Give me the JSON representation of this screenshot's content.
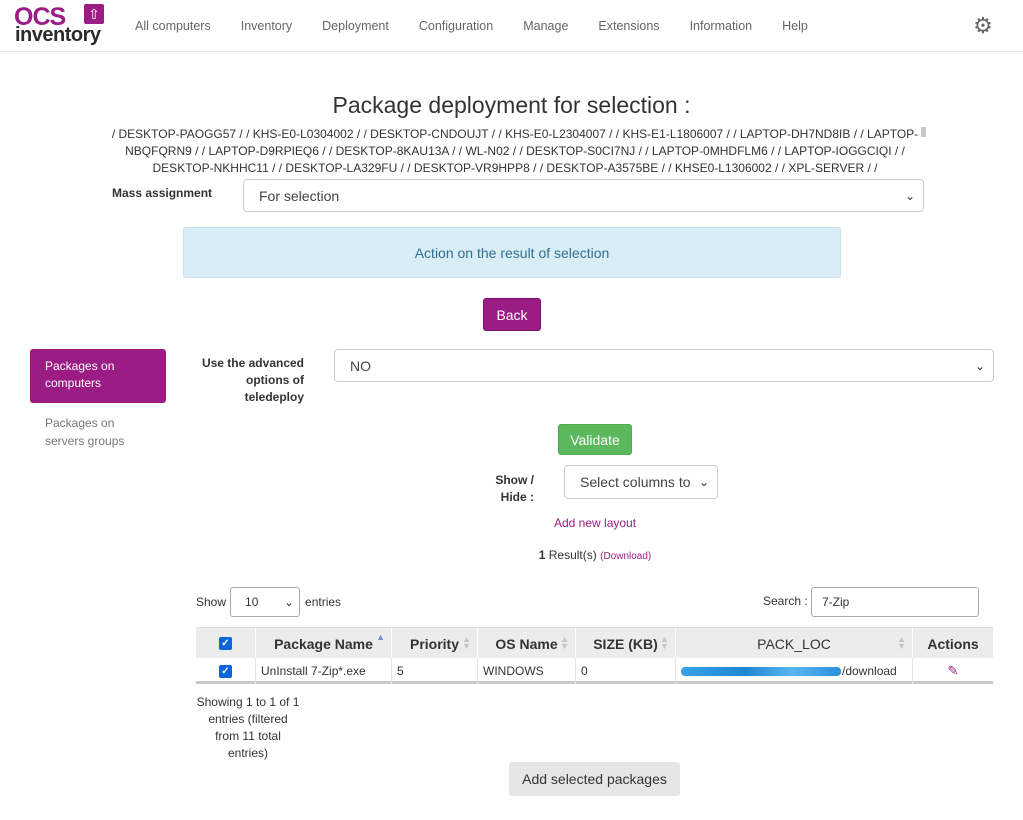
{
  "brand": {
    "logo_top": "OCS",
    "logo_bottom": "inventory"
  },
  "nav": {
    "items": [
      {
        "label": "All computers"
      },
      {
        "label": "Inventory"
      },
      {
        "label": "Deployment"
      },
      {
        "label": "Configuration"
      },
      {
        "label": "Manage"
      },
      {
        "label": "Extensions"
      },
      {
        "label": "Information"
      },
      {
        "label": "Help"
      }
    ],
    "settings_icon": "gear-icon"
  },
  "page": {
    "title": "Package deployment for selection :",
    "selection_list": "/ DESKTOP-PAOGG57 / / KHS-E0-L0304002 / / DESKTOP-CNDOUJT / / KHS-E0-L2304007 / / KHS-E1-L1806007 / / LAPTOP-DH7ND8IB / / LAPTOP-NBQFQRN9 / / LAPTOP-D9RPIEQ6 / / DESKTOP-8KAU13A / / WL-N02 / / DESKTOP-S0CI7NJ / / LAPTOP-0MHDFLM6 / / LAPTOP-IOGGCIQI / / DESKTOP-NKHHC11 / / DESKTOP-LA329FU / / DESKTOP-VR9HPP8 / / DESKTOP-A3575BE / / KHSE0-L1306002 / / XPL-SERVER / /",
    "mass_assignment_label": "Mass assignment",
    "mass_assignment_value": "For selection",
    "action_info": "Action on the result of selection",
    "back_label": "Back"
  },
  "sidebar": {
    "items": [
      {
        "label": "Packages on computers",
        "active": true
      },
      {
        "label": "Packages on servers groups",
        "active": false
      }
    ]
  },
  "form": {
    "advanced_label": "Use the advanced options of teledeploy",
    "advanced_value": "NO",
    "validate_label": "Validate",
    "show_hide_label": "Show / Hide :",
    "columns_placeholder": "Select columns to",
    "add_layout_label": "Add new layout"
  },
  "results": {
    "count": "1",
    "suffix": " Result(s) ",
    "download_label": "(Download)"
  },
  "table_controls": {
    "show_label": "Show",
    "entries_value": "10",
    "entries_label": "entries",
    "search_label": "Search :",
    "search_value": "7-Zip"
  },
  "table": {
    "columns": [
      "Package Name",
      "Priority",
      "OS Name",
      "SIZE (KB)",
      "PACK_LOC",
      "Actions"
    ],
    "rows": [
      {
        "package_name": "UnInstall 7-Zip*.exe",
        "priority": "5",
        "os_name": "WINDOWS",
        "size": "0",
        "pack_loc_suffix": "/download",
        "checked": true
      }
    ],
    "info": "Showing 1 to 1 of 1 entries (filtered from 11 total entries)"
  },
  "footer": {
    "add_selected_label": "Add selected packages"
  },
  "colors": {
    "brand": "#9b1c84",
    "success": "#5cb85c",
    "info_bg": "#d9edf7",
    "info_text": "#31708f"
  }
}
